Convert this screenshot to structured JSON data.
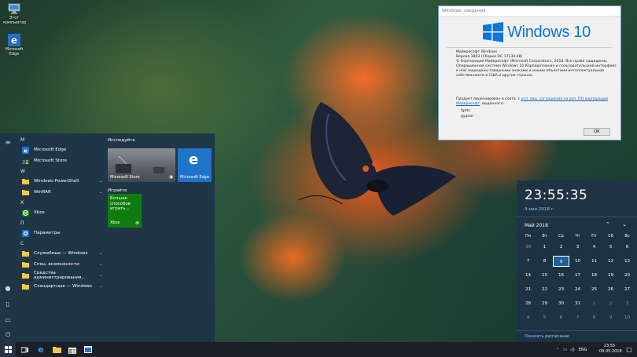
{
  "desktop": {
    "icons": [
      {
        "label": "Этот компьютер",
        "icon": "computer-icon"
      },
      {
        "label": "Microsoft Edge",
        "icon": "edge-icon"
      }
    ]
  },
  "start_menu": {
    "sections": [
      {
        "letter": "M",
        "apps": [
          {
            "label": "Microsoft Edge",
            "icon": "edge-icon"
          },
          {
            "label": "Microsoft Store",
            "icon": "store-icon"
          }
        ]
      },
      {
        "letter": "W",
        "apps": [
          {
            "label": "Windows PowerShell",
            "icon": "folder-icon",
            "chevron": "⌄"
          },
          {
            "label": "WinRAR",
            "icon": "folder-icon",
            "chevron": "⌄"
          }
        ]
      },
      {
        "letter": "X",
        "apps": [
          {
            "label": "Xbox",
            "icon": "xbox-icon"
          }
        ]
      },
      {
        "letter": "П",
        "apps": [
          {
            "label": "Параметры",
            "icon": "gear-icon"
          }
        ]
      },
      {
        "letter": "С",
        "apps": [
          {
            "label": "Служебные — Windows",
            "icon": "folder-icon",
            "chevron": "⌄"
          },
          {
            "label": "Спец. возможности",
            "icon": "folder-icon",
            "chevron": "⌄"
          },
          {
            "label": "Средства администрирования...",
            "icon": "folder-icon",
            "chevron": "⌄"
          },
          {
            "label": "Стандартные — Windows",
            "icon": "folder-icon",
            "chevron": "⌄"
          }
        ]
      }
    ],
    "tile_groups": {
      "explore": "Исследуйте",
      "play": "Играйте"
    },
    "tiles": {
      "store": "Microsoft Store",
      "edge": "Microsoft Edge",
      "xbox_promo": "Больше способов играть...",
      "xbox": "Xbox"
    }
  },
  "winver": {
    "title": "Windows: сведения",
    "brand": "Windows 10",
    "product": "Майкрософт Windows",
    "version": "Версия 1803 (Сборка ОС 17134.48)",
    "copyright": "© Корпорация Майкрософт (Microsoft Corporation), 2018. Все права защищены.",
    "description": "Операционная система Windows 10 Корпоративная и пользовательский интерфейс к ней защищены товарными знаками и иными объектами интеллектуальной собственности в США и других странах.",
    "license_prefix": "Продукт лицензирован в соотв. с",
    "license_link": "усл. лиц. соглашения на исп. ПО корпорации Майкрософт",
    "license_suffix": ", выданного:",
    "user1": "fgdtn",
    "user2": "gygnor",
    "ok": "ОК"
  },
  "clock": {
    "time": "23:55:35",
    "date": "9 мая 2018 г.",
    "month": "Май 2018",
    "weekdays": [
      "Пн",
      "Вт",
      "Ср",
      "Чт",
      "Пт",
      "Сб",
      "Вс"
    ],
    "weeks": [
      [
        {
          "d": "30",
          "dim": true
        },
        {
          "d": "1"
        },
        {
          "d": "2"
        },
        {
          "d": "3"
        },
        {
          "d": "4"
        },
        {
          "d": "5"
        },
        {
          "d": "6"
        }
      ],
      [
        {
          "d": "7"
        },
        {
          "d": "8"
        },
        {
          "d": "9",
          "today": true
        },
        {
          "d": "10"
        },
        {
          "d": "11"
        },
        {
          "d": "12"
        },
        {
          "d": "13"
        }
      ],
      [
        {
          "d": "14"
        },
        {
          "d": "15"
        },
        {
          "d": "16"
        },
        {
          "d": "17"
        },
        {
          "d": "18"
        },
        {
          "d": "19"
        },
        {
          "d": "20"
        }
      ],
      [
        {
          "d": "21"
        },
        {
          "d": "22"
        },
        {
          "d": "23"
        },
        {
          "d": "24"
        },
        {
          "d": "25"
        },
        {
          "d": "26"
        },
        {
          "d": "27"
        }
      ],
      [
        {
          "d": "28"
        },
        {
          "d": "29"
        },
        {
          "d": "30"
        },
        {
          "d": "31"
        },
        {
          "d": "1",
          "dim": true
        },
        {
          "d": "2",
          "dim": true
        },
        {
          "d": "3",
          "dim": true
        }
      ],
      [
        {
          "d": "4",
          "dim": true
        },
        {
          "d": "5",
          "dim": true
        },
        {
          "d": "6",
          "dim": true
        },
        {
          "d": "7",
          "dim": true
        },
        {
          "d": "8",
          "dim": true
        },
        {
          "d": "9",
          "dim": true
        },
        {
          "d": "10",
          "dim": true
        }
      ]
    ],
    "footer": "Показать расписание"
  },
  "taskbar": {
    "lang": "ENG",
    "time": "23:55",
    "date": "09.05.2018"
  },
  "colors": {
    "accent": "#0a78d4",
    "xbox_green": "#107c10"
  }
}
